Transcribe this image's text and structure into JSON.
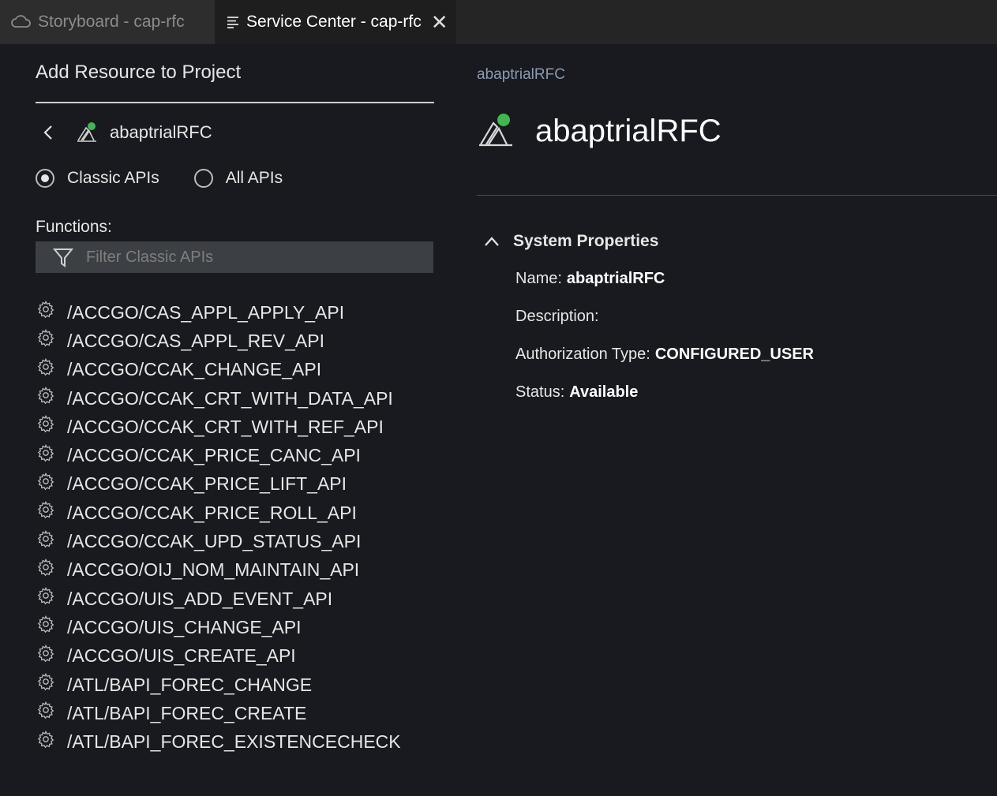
{
  "tabs": [
    {
      "label": "Storyboard - cap-rfc",
      "icon": "cloud-icon",
      "active": false
    },
    {
      "label": "Service Center - cap-rfc",
      "icon": "list-icon",
      "active": true,
      "close": "✕"
    }
  ],
  "left_panel": {
    "title": "Add Resource to Project",
    "breadcrumb": {
      "label": "abaptrialRFC"
    },
    "radios": [
      {
        "label": "Classic APIs",
        "checked": true
      },
      {
        "label": "All APIs",
        "checked": false
      }
    ],
    "functions_label": "Functions:",
    "filter_placeholder": "Filter Classic APIs",
    "functions": [
      "/ACCGO/CAS_APPL_APPLY_API",
      "/ACCGO/CAS_APPL_REV_API",
      "/ACCGO/CCAK_CHANGE_API",
      "/ACCGO/CCAK_CRT_WITH_DATA_API",
      "/ACCGO/CCAK_CRT_WITH_REF_API",
      "/ACCGO/CCAK_PRICE_CANC_API",
      "/ACCGO/CCAK_PRICE_LIFT_API",
      "/ACCGO/CCAK_PRICE_ROLL_API",
      "/ACCGO/CCAK_UPD_STATUS_API",
      "/ACCGO/OIJ_NOM_MAINTAIN_API",
      "/ACCGO/UIS_ADD_EVENT_API",
      "/ACCGO/UIS_CHANGE_API",
      "/ACCGO/UIS_CREATE_API",
      "/ATL/BAPI_FOREC_CHANGE",
      "/ATL/BAPI_FOREC_CREATE",
      "/ATL/BAPI_FOREC_EXISTENCECHECK"
    ]
  },
  "right_panel": {
    "breadcrumb": "abaptrialRFC",
    "title": "abaptrialRFC",
    "section_title": "System Properties",
    "properties": {
      "name_label": "Name:",
      "name_value": "abaptrialRFC",
      "description_label": "Description:",
      "auth_label": "Authorization Type:",
      "auth_value": "CONFIGURED_USER",
      "status_label": "Status:",
      "status_value": "Available"
    }
  },
  "colors": {
    "background": "#181a1f",
    "status_dot": "#3fb94f",
    "filter_bg": "#3c3f44"
  }
}
